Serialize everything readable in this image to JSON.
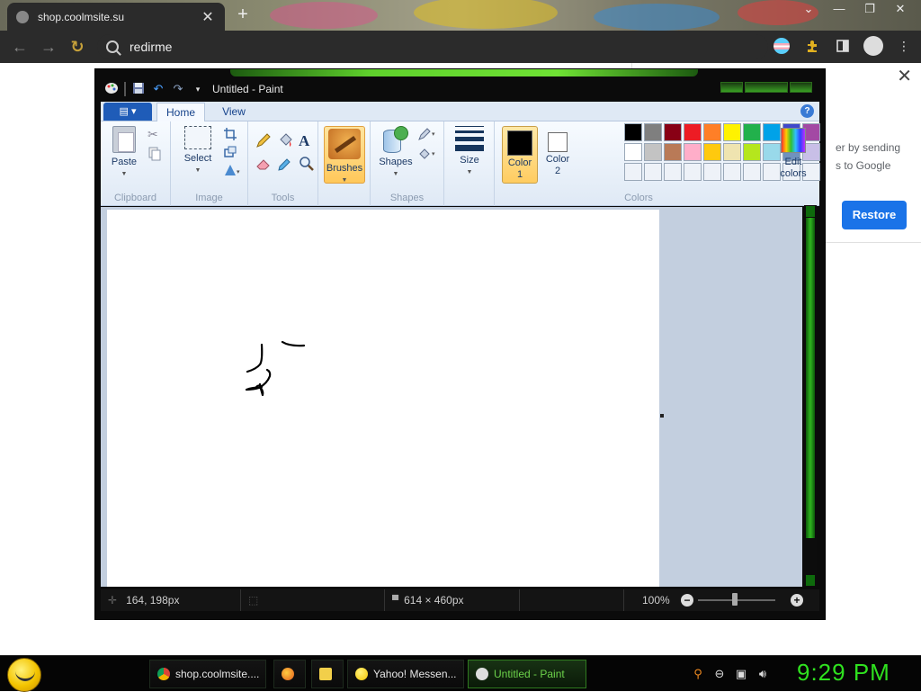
{
  "browser": {
    "tab": {
      "title": "shop.coolmsite.su",
      "close_glyph": "✕"
    },
    "new_tab_glyph": "+",
    "window_controls": [
      "⌄",
      "—",
      "❐",
      "✕"
    ],
    "nav": {
      "back": "←",
      "forward": "→",
      "reload": "↻"
    },
    "omnibox": {
      "value": "redirme"
    },
    "toolbar_icons": [
      "pride-flag-icon",
      "extensions-icon",
      "sidebar-icon",
      "profile-icon",
      "menu-icon"
    ],
    "menu_glyph": "⋮"
  },
  "popup": {
    "close_glyph": "✕",
    "text_line1": "er by sending",
    "text_line2": "s to Google",
    "restore_label": "Restore",
    "accent": "#1a73e8"
  },
  "paint": {
    "title": "Untitled - Paint",
    "tabs": {
      "file_glyph": "▤ ▾",
      "home": "Home",
      "view": "View"
    },
    "help_glyph": "?",
    "groups": {
      "clipboard": {
        "label": "Clipboard",
        "paste": "Paste"
      },
      "image": {
        "label": "Image",
        "select": "Select"
      },
      "tools": {
        "label": "Tools",
        "text_glyph": "A"
      },
      "brushes": {
        "label": "Brushes"
      },
      "shapes": {
        "label": "Shapes",
        "shapes": "Shapes"
      },
      "size": {
        "label": "Size"
      },
      "colors": {
        "label": "Colors",
        "color1_line1": "Color",
        "color1_line2": "1",
        "color2_line1": "Color",
        "color2_line2": "2",
        "edit_line1": "Edit",
        "edit_line2": "colors",
        "color1_value": "#000000",
        "color2_value": "#ffffff",
        "palette_row1": [
          "#000000",
          "#7f7f7f",
          "#880015",
          "#ed1c24",
          "#ff7f27",
          "#fff200",
          "#22b14c",
          "#00a2e8",
          "#3f48cc",
          "#a349a4"
        ],
        "palette_row2": [
          "#ffffff",
          "#c3c3c3",
          "#b97a57",
          "#ffaec9",
          "#ffc90e",
          "#efe4b0",
          "#b5e61d",
          "#99d9ea",
          "#7092be",
          "#c8bfe7"
        ],
        "palette_row3": [
          "#eef2f8",
          "#eef2f8",
          "#eef2f8",
          "#eef2f8",
          "#eef2f8",
          "#eef2f8",
          "#eef2f8",
          "#eef2f8",
          "#eef2f8",
          "#eef2f8"
        ]
      }
    },
    "status": {
      "cursor_pos": "164, 198px",
      "canvas_size": "614 × 460px",
      "zoom": "100%",
      "zoom_minus": "−",
      "zoom_plus": "+"
    }
  },
  "taskbar": {
    "items": [
      {
        "label": "shop.coolmsite....",
        "icon": "chrome-icon"
      },
      {
        "label": "",
        "icon": "firefox-icon"
      },
      {
        "label": "",
        "icon": "folder-icon"
      },
      {
        "label": "Yahoo! Messen...",
        "icon": "yahoo-messenger-icon"
      },
      {
        "label": "Untitled - Paint",
        "icon": "paint-icon"
      }
    ],
    "clock": "9:29 PM"
  }
}
